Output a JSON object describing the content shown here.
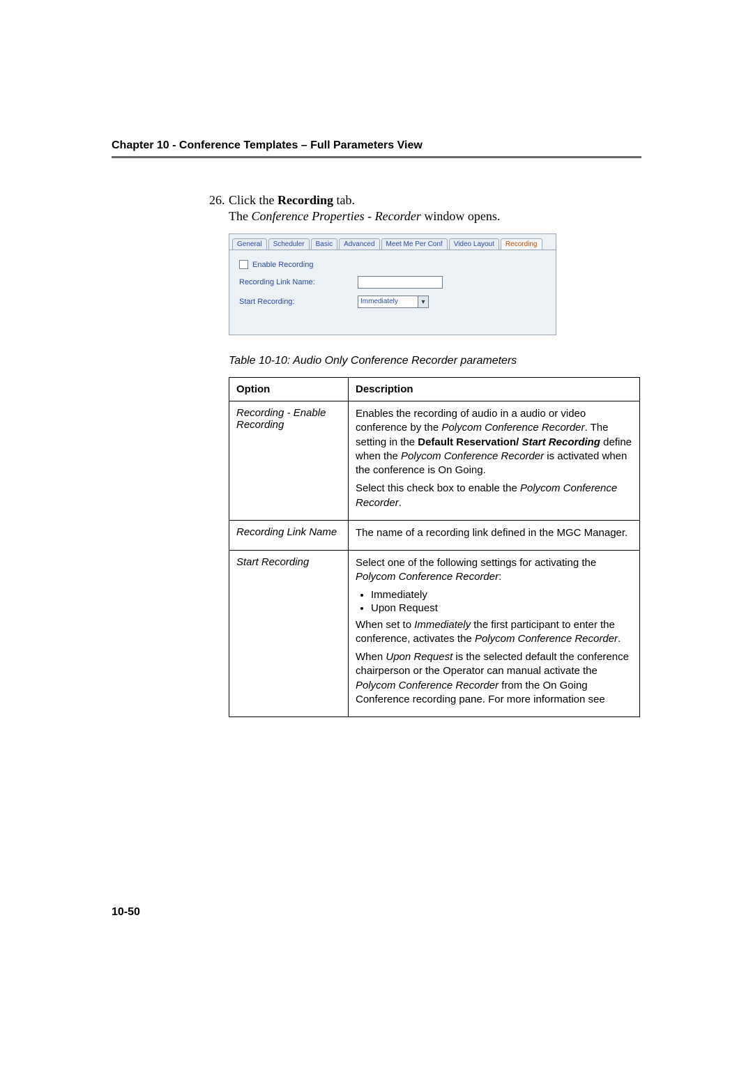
{
  "header": {
    "chapter": "Chapter 10 - Conference Templates – Full Parameters View"
  },
  "step": {
    "number": "26.",
    "prefix": "Click the ",
    "bold": "Recording",
    "suffix": " tab."
  },
  "open_line": {
    "pre": "The ",
    "italic": "Conference Properties - Recorder",
    "post": " window opens."
  },
  "dialog": {
    "tabs": [
      "General",
      "Scheduler",
      "Basic",
      "Advanced",
      "Meet Me Per Conf",
      "Video Layout",
      "Recording"
    ],
    "active_tab": "Recording",
    "enable_label": "Enable Recording",
    "link_label": "Recording Link Name:",
    "start_label": "Start Recording:",
    "start_value": "Immediately"
  },
  "caption": "Table 10-10: Audio Only Conference Recorder parameters",
  "table": {
    "head": {
      "option": "Option",
      "description": "Description"
    }
  },
  "row1": {
    "option": "Recording - Enable Recording",
    "p1a": "Enables the recording of audio in a audio or video conference by the ",
    "p1b": "Polycom Conference Recorder",
    "p1c": ". The setting in the ",
    "p1d": "Default Reservation/ ",
    "p1e": "Start Recording",
    "p1f": " define when the ",
    "p1g": "Polycom Conference Recorder",
    "p1h": " is activated when the conference is On Going.",
    "p2a": "Select this check box to enable the ",
    "p2b": "Polycom Conference Recorder",
    "p2c": "."
  },
  "row2": {
    "option": "Recording Link Name",
    "desc": "The name of a recording link defined in the MGC Manager."
  },
  "row3": {
    "option": "Start Recording",
    "p1a": "Select one of the following settings for activating the ",
    "p1b": "Polycom Conference Recorder",
    "p1c": ":",
    "li1": "Immediately",
    "li2": "Upon Request",
    "p2a": "When set to ",
    "p2b": "Immediately",
    "p2c": " the first participant to enter the conference, activates the ",
    "p2d": "Polycom Conference Recorder",
    "p2e": ".",
    "p3a": "When ",
    "p3b": "Upon Request",
    "p3c": " is the selected default the conference chairperson or the Operator can manual activate the ",
    "p3d": "Polycom Conference Recorder",
    "p3e": " from the On Going Conference recording pane. For more information see"
  },
  "page_number": "10-50"
}
